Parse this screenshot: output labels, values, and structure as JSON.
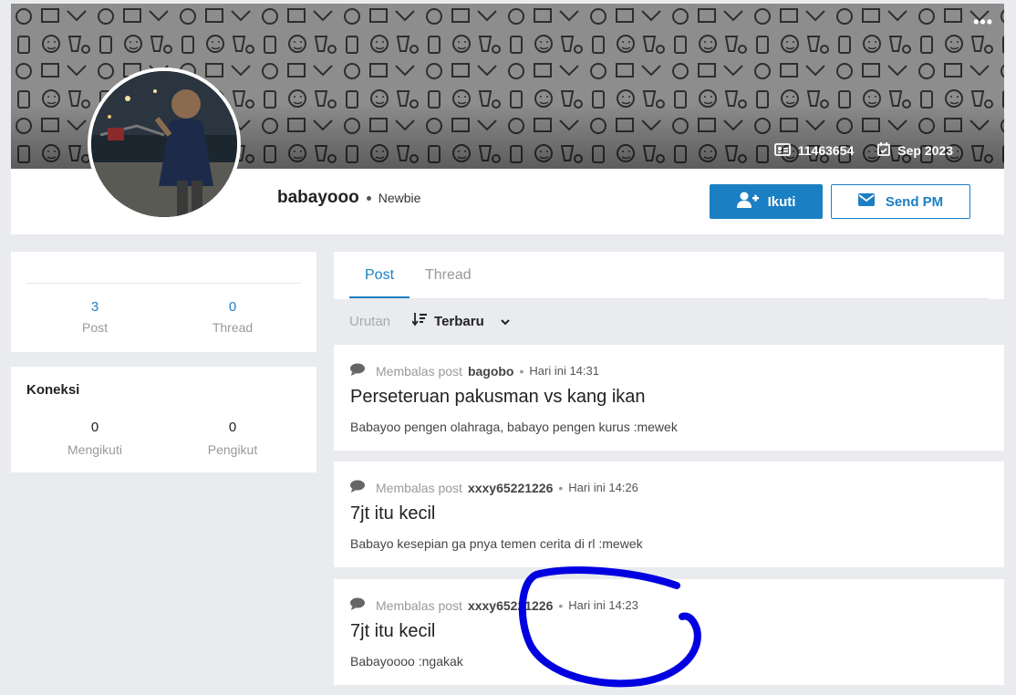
{
  "profile": {
    "username": "babayooo",
    "rank": "Newbie",
    "user_id": "11463654",
    "joined": "Sep 2023",
    "more_label": "•••",
    "follow_label": "Ikuti",
    "pm_label": "Send PM"
  },
  "stats": {
    "post_count": "3",
    "post_label": "Post",
    "thread_count": "0",
    "thread_label": "Thread"
  },
  "connections": {
    "title": "Koneksi",
    "following_count": "0",
    "following_label": "Mengikuti",
    "followers_count": "0",
    "followers_label": "Pengikut"
  },
  "tabs": [
    {
      "label": "Post",
      "active": true
    },
    {
      "label": "Thread",
      "active": false
    }
  ],
  "sort": {
    "label": "Urutan",
    "selected": "Terbaru"
  },
  "posts": [
    {
      "prefix": "Membalas post",
      "author": "bagobo",
      "time": "Hari ini 14:31",
      "title": "Perseteruan pakusman vs kang ikan",
      "body": "Babayoo pengen olahraga, babayo pengen kurus :mewek"
    },
    {
      "prefix": "Membalas post",
      "author": "xxxy65221226",
      "time": "Hari ini 14:26",
      "title": "7jt itu kecil",
      "body": "Babayo kesepian ga pnya temen cerita di rl :mewek"
    },
    {
      "prefix": "Membalas post",
      "author": "xxxy65221226",
      "time": "Hari ini 14:23",
      "title": "7jt itu kecil",
      "body": "Babayoooo :ngakak"
    }
  ],
  "colors": {
    "accent": "#1b80c3",
    "background": "#e9ebee",
    "annotation": "#0000e0"
  }
}
